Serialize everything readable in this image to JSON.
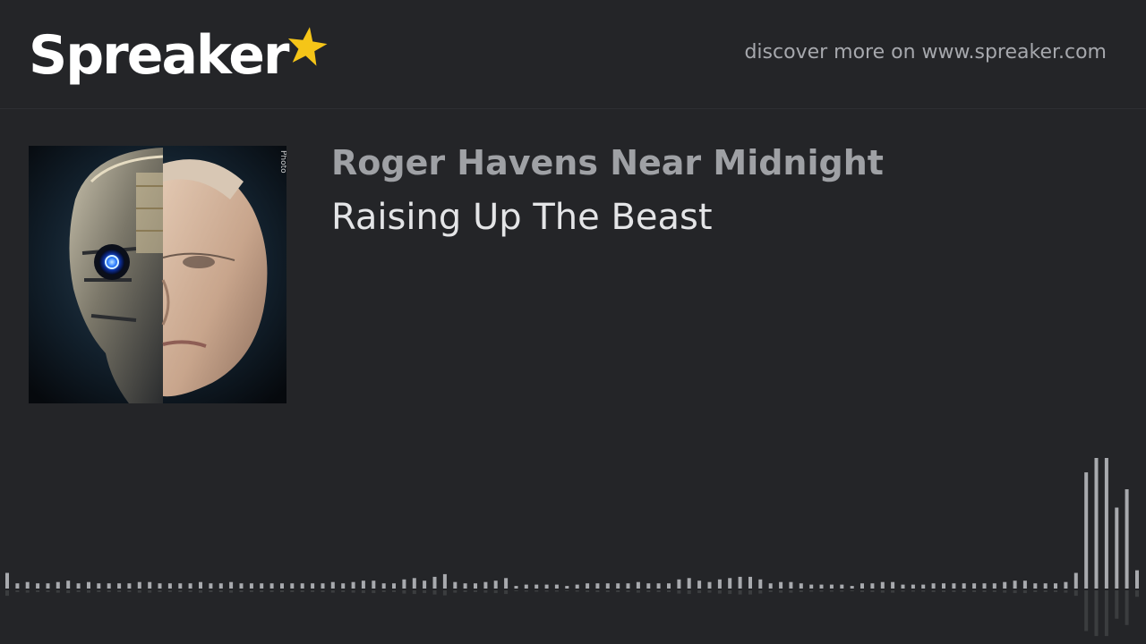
{
  "brand": {
    "name": "Spreaker",
    "accent_color": "#f5c518"
  },
  "header": {
    "discover_text": "discover more on www.spreaker.com"
  },
  "podcast": {
    "show_title": "Roger Havens Near Midnight",
    "episode_title": "Raising Up The Beast",
    "cover_watermark": "Photo"
  },
  "waveform": {
    "played_fraction": 1.0,
    "levels": [
      0.12,
      0.04,
      0.05,
      0.04,
      0.04,
      0.05,
      0.06,
      0.04,
      0.05,
      0.04,
      0.04,
      0.04,
      0.04,
      0.05,
      0.05,
      0.04,
      0.04,
      0.04,
      0.04,
      0.05,
      0.04,
      0.04,
      0.05,
      0.04,
      0.04,
      0.04,
      0.04,
      0.04,
      0.04,
      0.04,
      0.04,
      0.04,
      0.05,
      0.04,
      0.05,
      0.06,
      0.06,
      0.04,
      0.04,
      0.07,
      0.08,
      0.06,
      0.09,
      0.11,
      0.05,
      0.04,
      0.04,
      0.05,
      0.06,
      0.08,
      0.02,
      0.03,
      0.03,
      0.03,
      0.03,
      0.02,
      0.03,
      0.04,
      0.04,
      0.04,
      0.04,
      0.04,
      0.05,
      0.04,
      0.04,
      0.04,
      0.07,
      0.08,
      0.06,
      0.05,
      0.07,
      0.08,
      0.09,
      0.09,
      0.07,
      0.04,
      0.05,
      0.05,
      0.04,
      0.03,
      0.03,
      0.03,
      0.03,
      0.02,
      0.04,
      0.04,
      0.05,
      0.05,
      0.03,
      0.03,
      0.03,
      0.04,
      0.04,
      0.04,
      0.04,
      0.04,
      0.04,
      0.04,
      0.05,
      0.06,
      0.06,
      0.04,
      0.04,
      0.04,
      0.05,
      0.12,
      0.89,
      1.0,
      1.0,
      0.62,
      0.76,
      0.14
    ]
  }
}
